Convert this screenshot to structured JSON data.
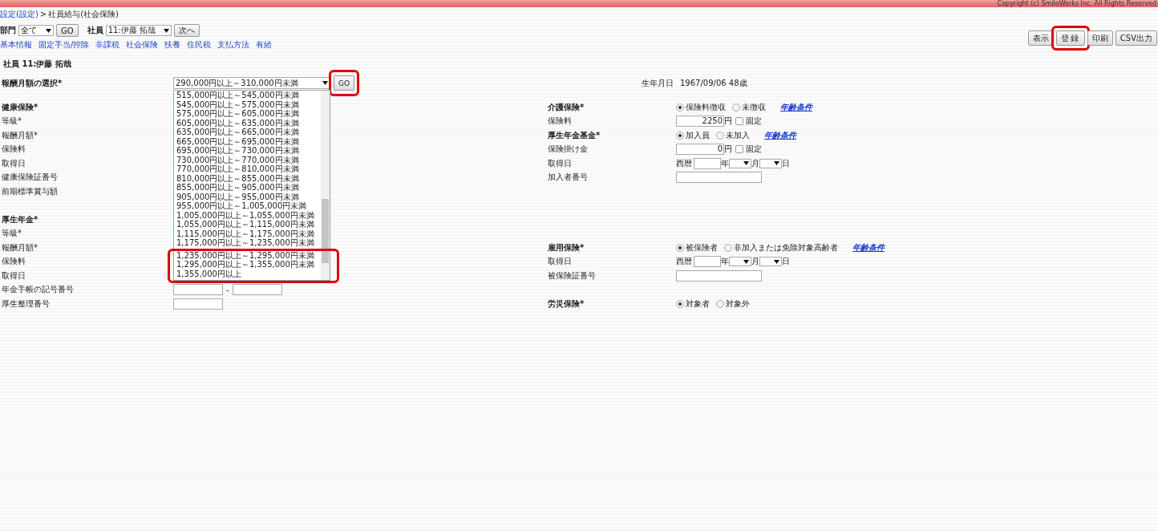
{
  "header": {
    "copyright": "Copyright (c) SmileWorks Inc. All Rights Reserved"
  },
  "breadcrumb": {
    "link": "設定(設定)",
    "separator": ">",
    "current": "社員給与(社会保険)"
  },
  "filters": {
    "department_label": "部門",
    "department_value": "全て",
    "go": "GO",
    "employee_label": "社員",
    "employee_value": "11:伊藤 拓哉",
    "next": "次へ"
  },
  "actions": [
    {
      "label": "表示",
      "highlighted": false
    },
    {
      "label": "登録",
      "highlighted": true
    },
    {
      "label": "印刷",
      "highlighted": false
    },
    {
      "label": "CSV出力",
      "highlighted": false
    }
  ],
  "nav_links": [
    "基本情報",
    "固定手当/控除",
    "非課税",
    "社会保険",
    "扶養",
    "住民税",
    "支払方法",
    "有給"
  ],
  "employee_title": "社員 11:伊藤 拓哉",
  "salary_select": {
    "label": "報酬月額の選択*",
    "value": "290,000円以上～310,000円未満",
    "go": "GO",
    "go_highlighted": true,
    "options": [
      {
        "label": "515,000円以上～545,000円未満",
        "highlighted": false
      },
      {
        "label": "545,000円以上～575,000円未満",
        "highlighted": false
      },
      {
        "label": "575,000円以上～605,000円未満",
        "highlighted": false
      },
      {
        "label": "605,000円以上～635,000円未満",
        "highlighted": false
      },
      {
        "label": "635,000円以上～665,000円未満",
        "highlighted": false
      },
      {
        "label": "665,000円以上～695,000円未満",
        "highlighted": false
      },
      {
        "label": "695,000円以上～730,000円未満",
        "highlighted": false
      },
      {
        "label": "730,000円以上～770,000円未満",
        "highlighted": false
      },
      {
        "label": "770,000円以上～810,000円未満",
        "highlighted": false
      },
      {
        "label": "810,000円以上～855,000円未満",
        "highlighted": false
      },
      {
        "label": "855,000円以上～905,000円未満",
        "highlighted": false
      },
      {
        "label": "905,000円以上～955,000円未満",
        "highlighted": false
      },
      {
        "label": "955,000円以上～1,005,000円未満",
        "highlighted": false
      },
      {
        "label": "1,005,000円以上～1,055,000円未満",
        "highlighted": false
      },
      {
        "label": "1,055,000円以上～1,115,000円未満",
        "highlighted": false
      },
      {
        "label": "1,115,000円以上～1,175,000円未満",
        "highlighted": false
      },
      {
        "label": "1,175,000円以上～1,235,000円未満",
        "highlighted": false
      },
      {
        "label": "1,235,000円以上～1,295,000円未満",
        "highlighted": true
      },
      {
        "label": "1,295,000円以上～1,355,000円未満",
        "highlighted": true
      },
      {
        "label": "1,355,000円以上",
        "highlighted": true
      }
    ]
  },
  "left_sections": [
    {
      "title": "健康保険*",
      "rows": [
        {
          "kind": "plain",
          "label": "等級*"
        },
        {
          "kind": "plain",
          "label": "報酬月額*"
        },
        {
          "kind": "plain",
          "label": "保険料"
        },
        {
          "kind": "plain",
          "label": "取得日"
        },
        {
          "kind": "plain",
          "label": "健康保険証番号"
        },
        {
          "kind": "plain",
          "label": "前期標準賞与額"
        }
      ]
    },
    {
      "title": "厚生年金*",
      "rows": [
        {
          "kind": "plain",
          "label": "等級*"
        },
        {
          "kind": "plain",
          "label": "報酬月額*"
        },
        {
          "kind": "plain",
          "label": "保険料"
        },
        {
          "kind": "plain",
          "label": "取得日"
        },
        {
          "kind": "split",
          "label": "年金手帳の記号番号",
          "separator": "-"
        },
        {
          "kind": "input",
          "label": "厚生整理番号"
        }
      ]
    }
  ],
  "birth": {
    "label": "生年月日",
    "value": "1967/09/06 48歳"
  },
  "right_sections": [
    {
      "title": "介護保険*",
      "options": [
        {
          "label": "保険料徴収",
          "selected": true
        },
        {
          "label": "未徴収",
          "selected": false
        }
      ],
      "link": "年齢条件",
      "rows": [
        {
          "kind": "amount",
          "label": "保険料",
          "value": "2250",
          "unit": "円",
          "check_label": "固定",
          "checked": false
        }
      ]
    },
    {
      "title": "厚生年金基金*",
      "options": [
        {
          "label": "加入員",
          "selected": true
        },
        {
          "label": "未加入",
          "selected": false
        }
      ],
      "link": "年齢条件",
      "rows": [
        {
          "kind": "amount",
          "label": "保険掛け金",
          "value": "0",
          "unit": "円",
          "check_label": "固定",
          "checked": false
        },
        {
          "kind": "date",
          "label": "取得日",
          "era": "西暦",
          "year_unit": "年",
          "month_unit": "月",
          "day_unit": "日"
        },
        {
          "kind": "input",
          "label": "加入者番号"
        }
      ]
    },
    {
      "title": "雇用保険*",
      "options": [
        {
          "label": "被保険者",
          "selected": true
        },
        {
          "label": "非加入または免除対象高齢者",
          "selected": false
        }
      ],
      "link": "年齢条件",
      "rows": [
        {
          "kind": "date",
          "label": "取得日",
          "era": "西暦",
          "year_unit": "年",
          "month_unit": "月",
          "day_unit": "日"
        },
        {
          "kind": "input",
          "label": "被保険証番号"
        }
      ]
    },
    {
      "title": "労災保険*",
      "options": [
        {
          "label": "対象者",
          "selected": true
        },
        {
          "label": "対象外",
          "selected": false
        }
      ]
    }
  ]
}
